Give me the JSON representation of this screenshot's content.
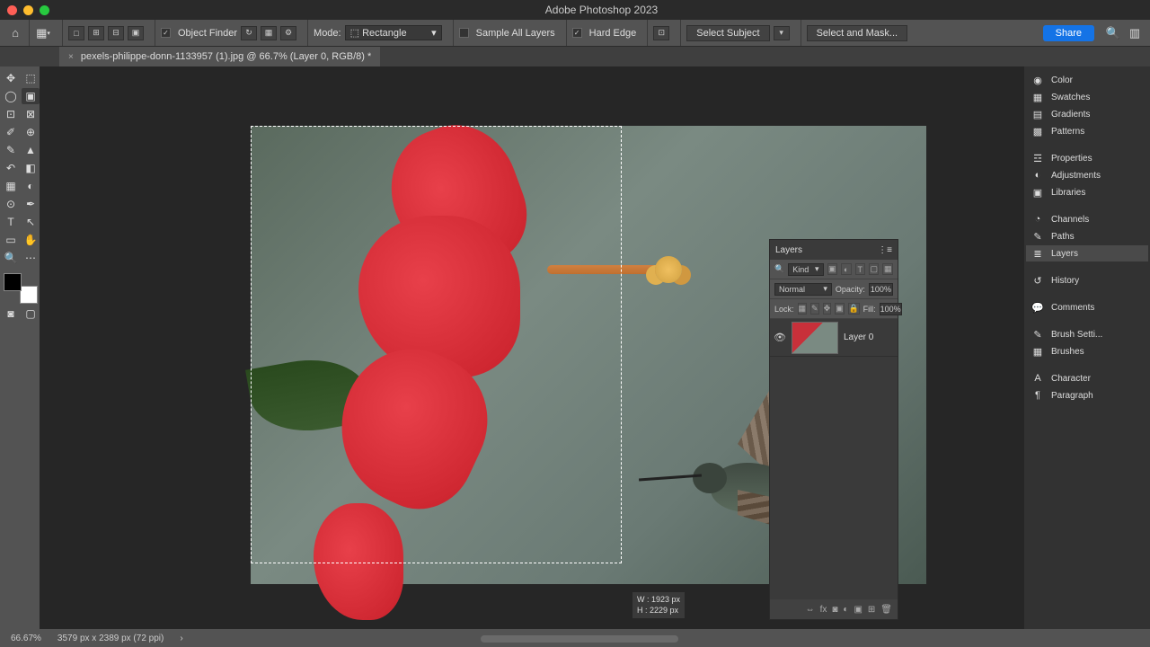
{
  "title": "Adobe Photoshop 2023",
  "options": {
    "object_finder": "Object Finder",
    "mode_label": "Mode:",
    "mode_value": "Rectangle",
    "sample_all": "Sample All Layers",
    "hard_edge": "Hard Edge",
    "select_subject": "Select Subject",
    "select_mask": "Select and Mask...",
    "share": "Share"
  },
  "tab": {
    "name": "pexels-philippe-donn-1133957 (1).jpg @ 66.7% (Layer 0, RGB/8) *"
  },
  "selection": {
    "w": "W : 1923 px",
    "h": "H : 2229 px"
  },
  "right_panels": {
    "color": "Color",
    "swatches": "Swatches",
    "gradients": "Gradients",
    "patterns": "Patterns",
    "properties": "Properties",
    "adjustments": "Adjustments",
    "libraries": "Libraries",
    "channels": "Channels",
    "paths": "Paths",
    "layers": "Layers",
    "history": "History",
    "comments": "Comments",
    "brush_settings": "Brush Setti...",
    "brushes": "Brushes",
    "character": "Character",
    "paragraph": "Paragraph"
  },
  "layers_panel": {
    "title": "Layers",
    "kind": "Kind",
    "blend": "Normal",
    "opacity_label": "Opacity:",
    "opacity": "100%",
    "lock": "Lock:",
    "fill_label": "Fill:",
    "fill": "100%",
    "layer0": "Layer 0"
  },
  "status": {
    "zoom": "66.67%",
    "dims": "3579 px x 2389 px (72 ppi)"
  }
}
